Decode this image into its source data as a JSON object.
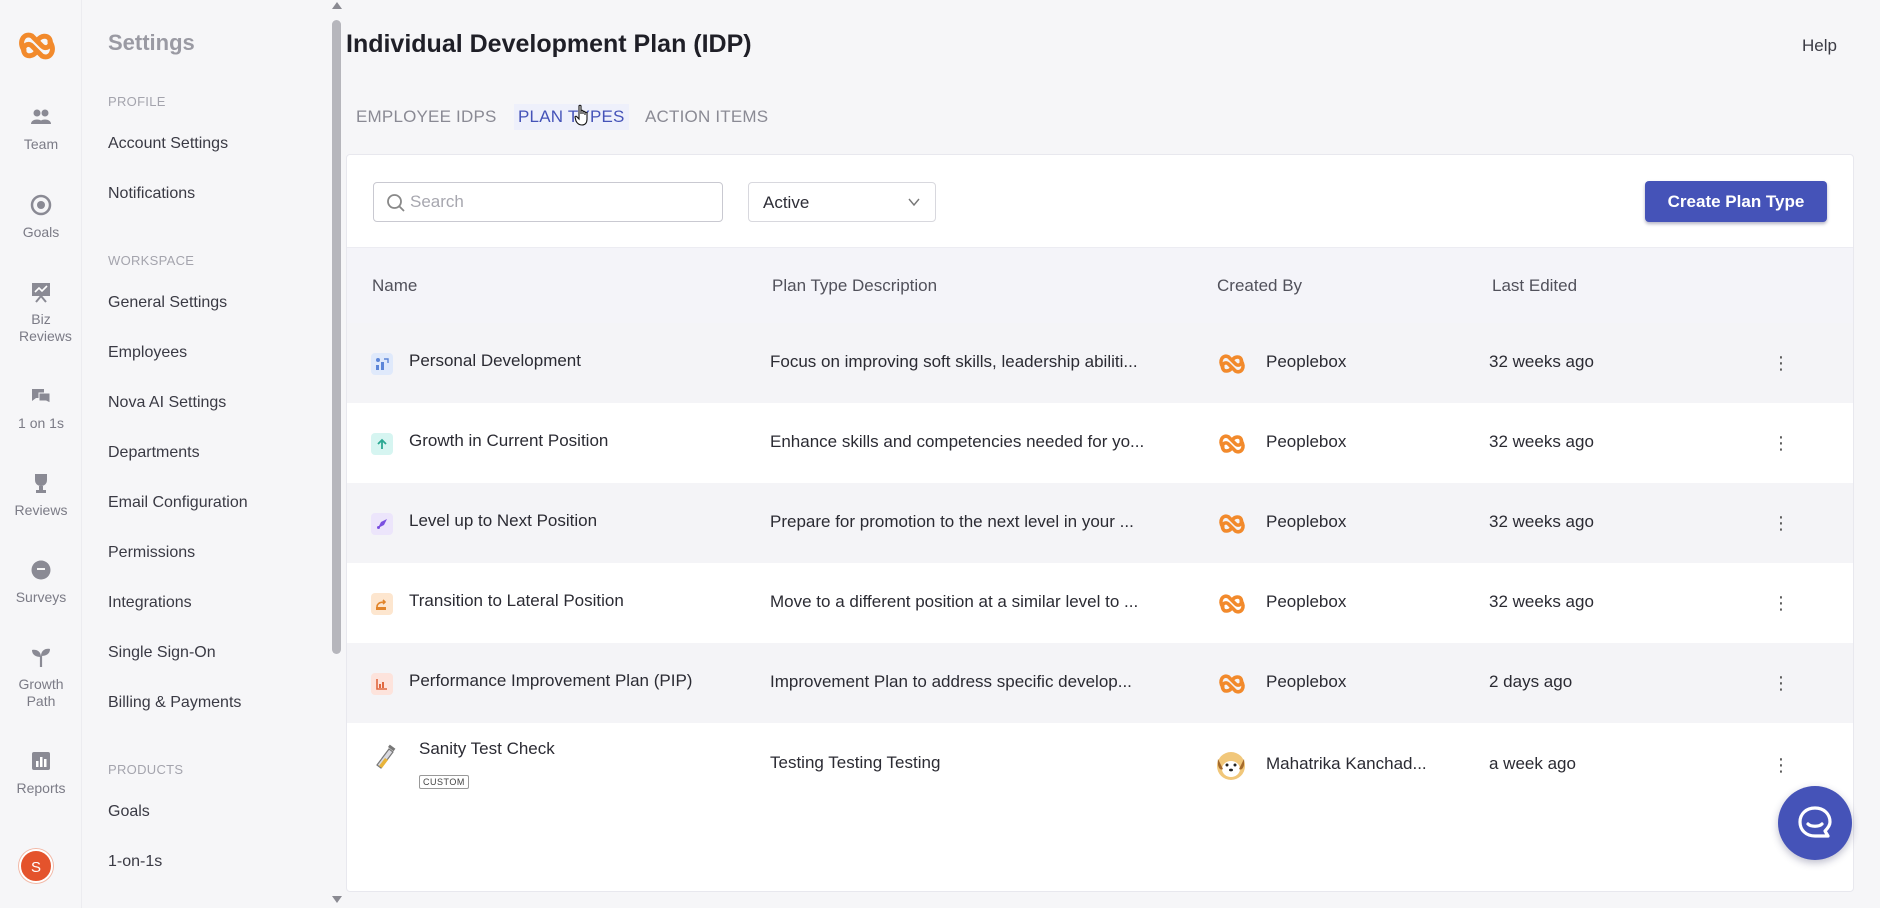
{
  "colors": {
    "accent": "#4553b8",
    "brand_orange": "#f28a2c",
    "avatar_bg": "#e4532c"
  },
  "rail": {
    "items": [
      {
        "label": "Team",
        "icon": "team-icon"
      },
      {
        "label": "Goals",
        "icon": "target-icon"
      },
      {
        "label": "Biz Reviews",
        "icon": "presentation-icon"
      },
      {
        "label": "1 on 1s",
        "icon": "chat-bubbles-icon"
      },
      {
        "label": "Reviews",
        "icon": "trophy-icon"
      },
      {
        "label": "Surveys",
        "icon": "survey-icon"
      },
      {
        "label": "Growth Path",
        "icon": "sprout-icon"
      },
      {
        "label": "Reports",
        "icon": "bar-chart-icon"
      }
    ],
    "avatar_initial": "S"
  },
  "sidebar": {
    "title": "Settings",
    "sections": {
      "profile": "PROFILE",
      "workspace": "WORKSPACE",
      "products": "PRODUCTS"
    },
    "profile_items": [
      "Account Settings",
      "Notifications"
    ],
    "workspace_items": [
      "General Settings",
      "Employees",
      "Nova AI Settings",
      "Departments",
      "Email Configuration",
      "Permissions",
      "Integrations",
      "Single Sign-On",
      "Billing & Payments"
    ],
    "product_items": [
      "Goals",
      "1-on-1s"
    ]
  },
  "header": {
    "title": "Individual Development Plan (IDP)",
    "help": "Help"
  },
  "tabs": [
    {
      "label": "EMPLOYEE IDPS",
      "active": false
    },
    {
      "label": "PLAN TYPES",
      "active": true
    },
    {
      "label": "ACTION ITEMS",
      "active": false
    }
  ],
  "toolbar": {
    "search_placeholder": "Search",
    "status_value": "Active",
    "create_label": "Create Plan Type"
  },
  "table": {
    "columns": [
      "Name",
      "Plan Type Description",
      "Created By",
      "Last Edited"
    ],
    "rows": [
      {
        "name": "Personal Development",
        "description": "Focus on improving soft skills, leadership abiliti...",
        "created_by": "Peoplebox",
        "last_edited": "32 weeks ago",
        "icon": "person-growth-icon",
        "icon_color": "#dfe9fb"
      },
      {
        "name": "Growth in Current Position",
        "description": "Enhance skills and competencies needed for yo...",
        "created_by": "Peoplebox",
        "last_edited": "32 weeks ago",
        "icon": "arrow-up-icon",
        "icon_color": "#d6f5f1"
      },
      {
        "name": "Level up to Next Position",
        "description": "Prepare for promotion to the next level in your ...",
        "created_by": "Peoplebox",
        "last_edited": "32 weeks ago",
        "icon": "rocket-icon",
        "icon_color": "#ece5fb"
      },
      {
        "name": "Transition to Lateral Position",
        "description": "Move to a different position at a similar level to ...",
        "created_by": "Peoplebox",
        "last_edited": "32 weeks ago",
        "icon": "lateral-move-icon",
        "icon_color": "#fde6cf"
      },
      {
        "name": "Performance Improvement Plan (PIP)",
        "description": "Improvement Plan to address specific develop...",
        "created_by": "Peoplebox",
        "last_edited": "2 days ago",
        "icon": "chart-icon",
        "icon_color": "#fde3dc"
      },
      {
        "name": "Sanity Test Check",
        "description": "Testing Testing Testing",
        "created_by": "Mahatrika Kanchad...",
        "last_edited": "a week ago",
        "icon": "test-tube-icon",
        "badge": "CUSTOM"
      }
    ]
  }
}
